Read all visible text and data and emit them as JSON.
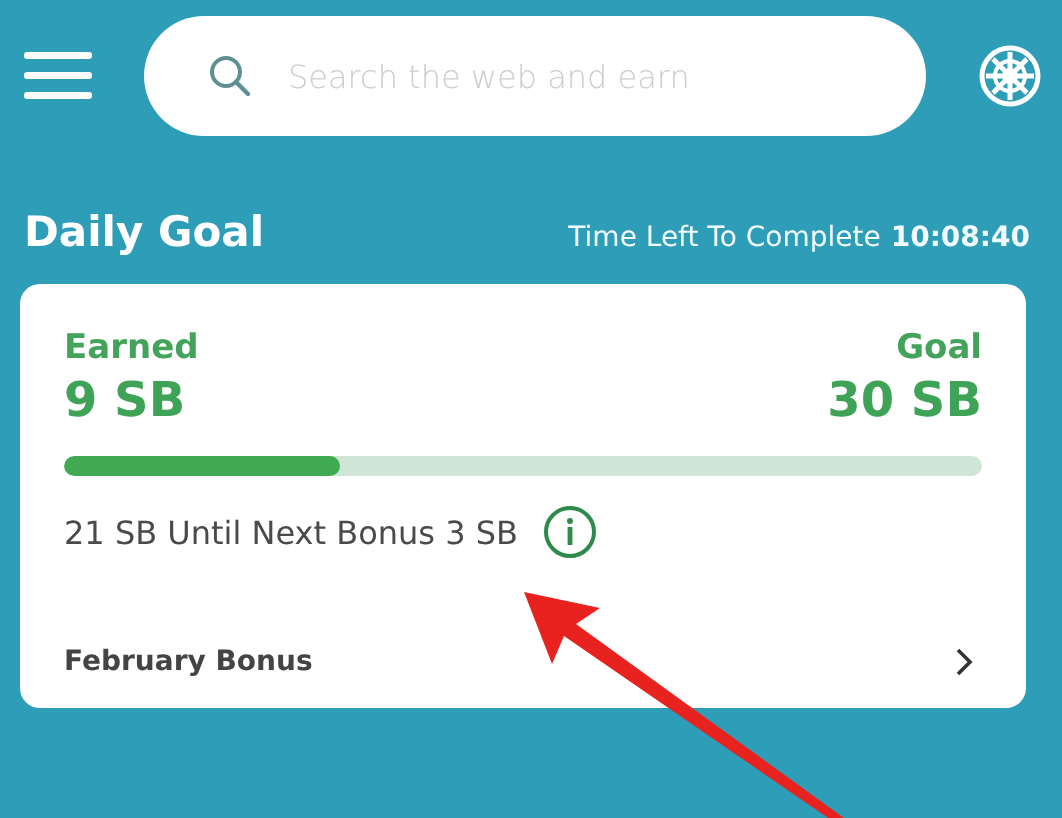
{
  "search": {
    "placeholder": "Search the web and earn"
  },
  "daily_goal": {
    "title": "Daily Goal",
    "time_left_label": "Time Left To Complete",
    "time_left": "10:08:40"
  },
  "card": {
    "earned_label": "Earned",
    "earned": "9 SB",
    "goal_label": "Goal",
    "goal": "30 SB",
    "level": 0.3,
    "bonus_text": "21 SB Until Next Bonus 3 SB",
    "link": "February Bonus"
  }
}
